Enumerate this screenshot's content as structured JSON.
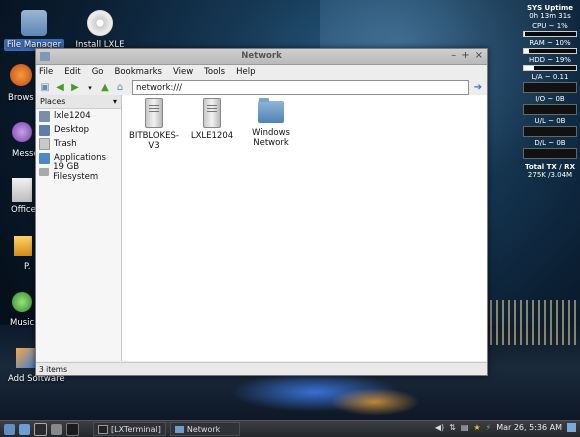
{
  "desktop": {
    "icons": [
      {
        "label": "File Manager",
        "selected": true
      },
      {
        "label": "Install LXLE",
        "selected": false
      }
    ],
    "partial_labels": [
      "Brows",
      "Messe",
      "Office",
      "P.",
      "Music",
      "Add Software"
    ]
  },
  "monitor": {
    "title": "SYS Uptime",
    "uptime": "0h 13m 31s",
    "cpu": "CPU ~ 1%",
    "ram": "RAM ~ 10%",
    "hdd": "HDD ~ 19%",
    "load": "L/A ~ 0.11",
    "io": "I/O ~ 0B",
    "upload": "U/L ~ 0B",
    "download": "D/L ~ 0B",
    "total_title": "Total TX / RX",
    "total_value": "275K /3.04M",
    "cpu_pct": 1,
    "ram_pct": 10,
    "hdd_pct": 19
  },
  "window": {
    "title": "Network",
    "menu": [
      "File",
      "Edit",
      "Go",
      "Bookmarks",
      "View",
      "Tools",
      "Help"
    ],
    "location": "network:///",
    "sidebar_header": "Places",
    "places": [
      {
        "label": "lxle1204",
        "icon": "home-icon"
      },
      {
        "label": "Desktop",
        "icon": "desktop-icon"
      },
      {
        "label": "Trash",
        "icon": "trash-icon"
      },
      {
        "label": "Applications",
        "icon": "applications-icon"
      },
      {
        "label": "19 GB Filesystem",
        "icon": "drive-icon"
      }
    ],
    "items": [
      {
        "label": "BITBLOKES-V3",
        "icon": "server-icon"
      },
      {
        "label": "LXLE1204",
        "icon": "server-icon"
      },
      {
        "label": "Windows Network",
        "icon": "network-folder-icon"
      }
    ],
    "status": "3 items"
  },
  "taskbar": {
    "tasks": [
      "[LXTerminal]",
      "Network"
    ],
    "clock": "Mar 26, 5:36 AM"
  }
}
